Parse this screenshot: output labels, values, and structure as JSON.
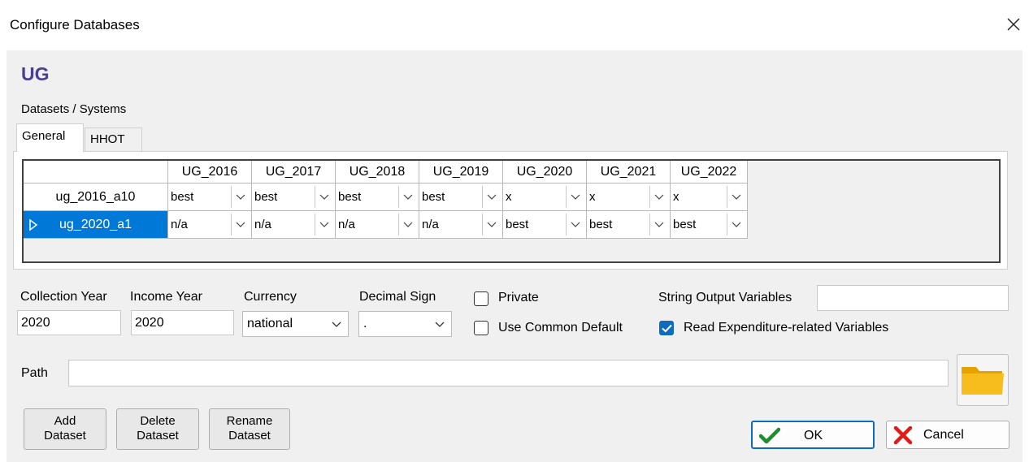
{
  "window": {
    "title": "Configure Databases",
    "close_icon": "close-icon"
  },
  "database": {
    "name": "UG"
  },
  "datasets_label": "Datasets / Systems",
  "tabs": [
    {
      "label": "General",
      "active": true
    },
    {
      "label": "HHOT",
      "active": false
    }
  ],
  "grid": {
    "columns": [
      "UG_2016",
      "UG_2017",
      "UG_2018",
      "UG_2019",
      "UG_2020",
      "UG_2021",
      "UG_2022"
    ],
    "rows": [
      {
        "name": "ug_2016_a10",
        "selected": false,
        "values": [
          "best",
          "best",
          "best",
          "best",
          "x",
          "x",
          "x"
        ]
      },
      {
        "name": "ug_2020_a1",
        "selected": true,
        "values": [
          "n/a",
          "n/a",
          "n/a",
          "n/a",
          "best",
          "best",
          "best"
        ]
      }
    ]
  },
  "form": {
    "collection_year": {
      "label": "Collection Year",
      "value": "2020"
    },
    "income_year": {
      "label": "Income Year",
      "value": "2020"
    },
    "currency": {
      "label": "Currency",
      "value": "national"
    },
    "decimal_sign": {
      "label": "Decimal Sign",
      "value": "."
    },
    "private": {
      "label": "Private",
      "checked": false
    },
    "use_common_default": {
      "label": "Use Common Default",
      "checked": false
    },
    "string_output": {
      "label": "String Output Variables",
      "value": ""
    },
    "read_expenditure": {
      "label": "Read Expenditure-related Variables",
      "checked": true
    },
    "path": {
      "label": "Path",
      "value": ""
    }
  },
  "buttons": {
    "add_line1": "Add",
    "add_line2": "Dataset",
    "delete_line1": "Delete",
    "delete_line2": "Dataset",
    "rename_line1": "Rename",
    "rename_line2": "Dataset",
    "ok": "OK",
    "cancel": "Cancel"
  },
  "colors": {
    "accent": "#0078d7",
    "title": "#4b3d8f",
    "ok_check": "#1a8f2a",
    "cancel_x": "#e11a1a",
    "folder": "#f5b400"
  }
}
